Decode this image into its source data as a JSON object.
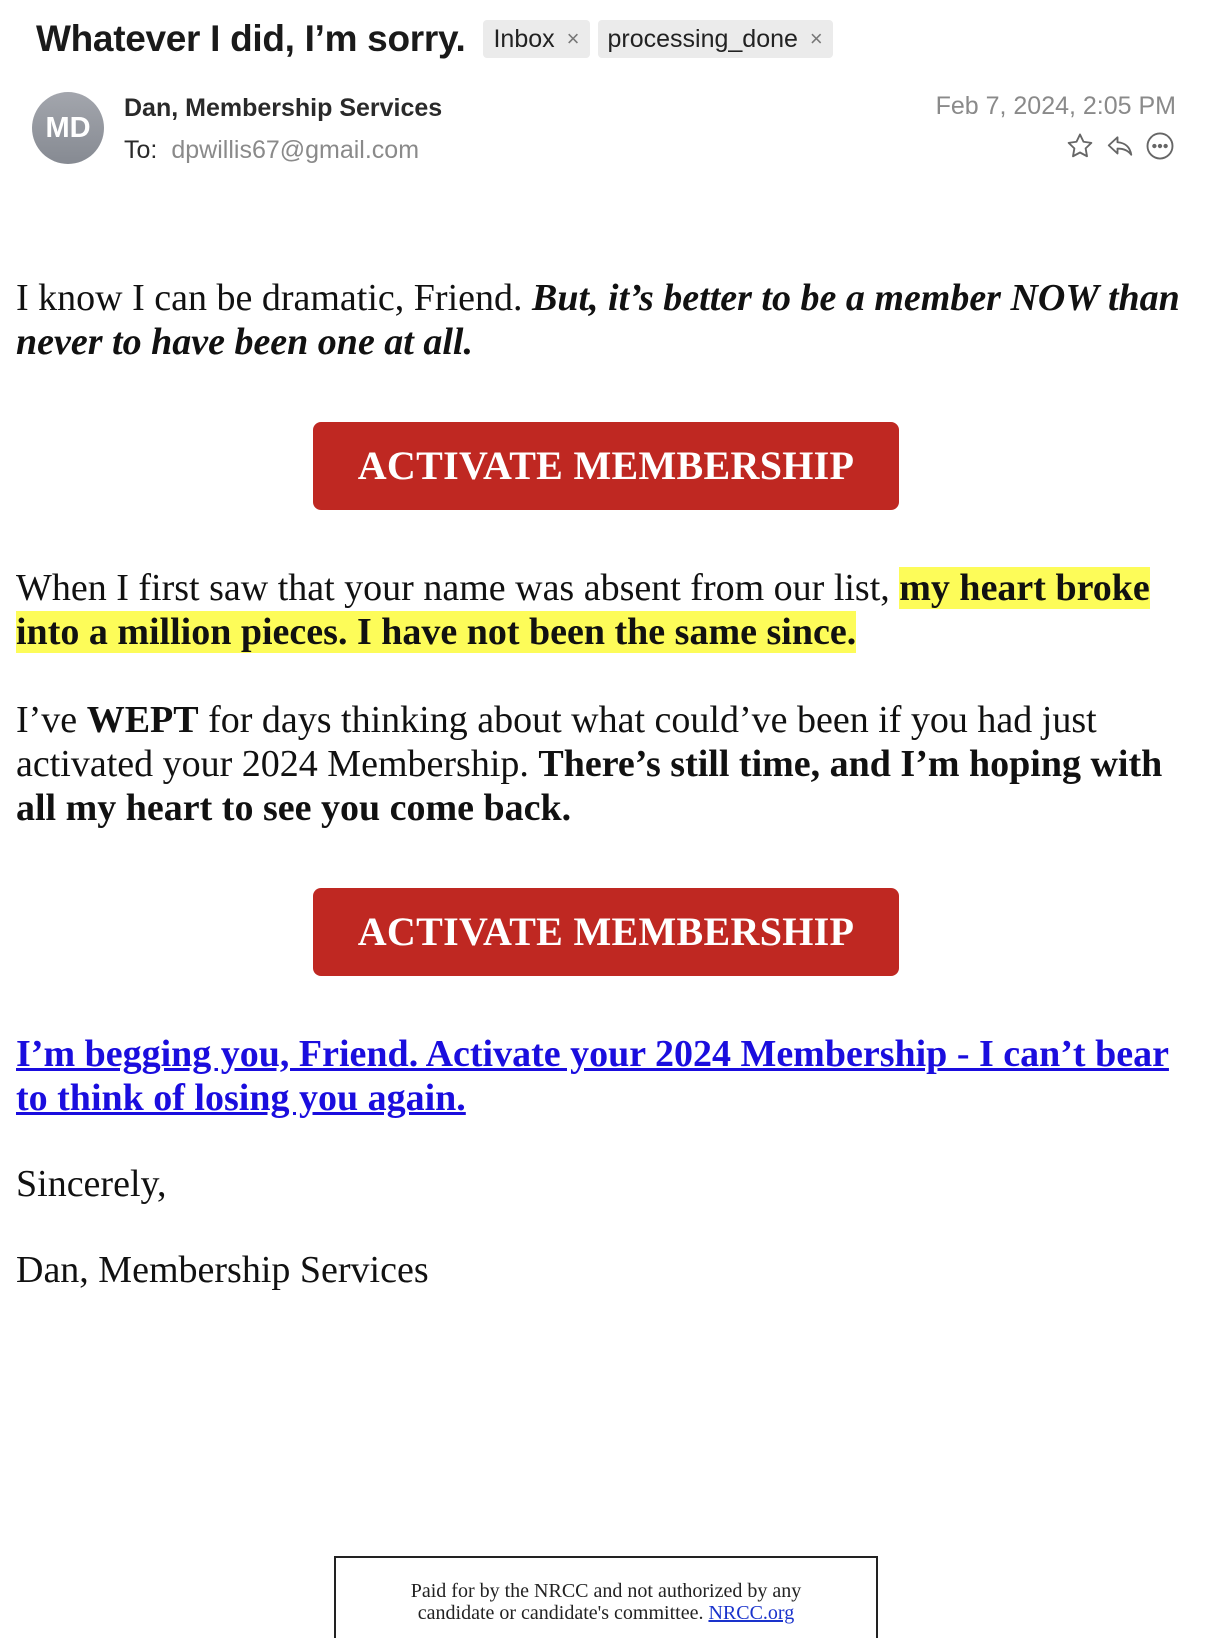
{
  "header": {
    "subject": "Whatever I did, I’m sorry.",
    "tags": [
      {
        "label": "Inbox",
        "remove": "×"
      },
      {
        "label": "processing_done",
        "remove": "×"
      }
    ],
    "avatar_initials": "MD",
    "sender": "Dan, Membership Services",
    "to_label": "To:",
    "to_address": "dpwillis67@gmail.com",
    "date": "Feb 7, 2024, 2:05 PM",
    "actions": [
      "star-icon",
      "reply-icon",
      "more-icon"
    ]
  },
  "body": {
    "p1_plain": "I know I can be dramatic, Friend. ",
    "p1_bold_italic": "But, it’s better to be a member NOW than never to have been one at all.",
    "button_label": "ACTIVATE MEMBERSHIP",
    "p2_plain": "When I first saw that your name was absent from our list, ",
    "p2_highlight": "my heart broke into a million pieces. I have not been the same since.",
    "p3_a": "I’ve ",
    "p3_b": "WEPT",
    "p3_c": " for days thinking about what could’ve been if you had just activated your 2024 Membership. ",
    "p3_d": "There’s still time, and I’m hoping with all my heart to see you come back.",
    "button2_label": "ACTIVATE MEMBERSHIP",
    "p4_link": "I’m begging you, Friend. Activate your 2024 Membership - I can’t bear to think of losing you again.",
    "closing": "Sincerely,",
    "signature": "Dan, Membership Services"
  },
  "footer": {
    "line1": "Paid for by the NRCC and not authorized by any",
    "line2": "candidate or candidate's committee. ",
    "link": "NRCC.org"
  },
  "colors": {
    "button": "#bf2822",
    "highlight": "#fdfc59",
    "link": "#1a0dde"
  }
}
